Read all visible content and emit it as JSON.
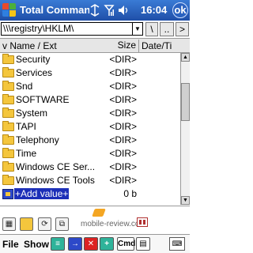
{
  "titlebar": {
    "title": "Total Comman",
    "clock": "16:04",
    "ok_label": "ok",
    "icons": [
      "start-logo-icon",
      "connectivity-icon",
      "signal-icon",
      "speaker-icon"
    ]
  },
  "pathbar": {
    "path": "\\\\\\registry\\HKLM\\",
    "buttons": [
      "\\",
      "..",
      ">"
    ]
  },
  "list_header": {
    "name_label": "v Name / Ext",
    "size_label": "Size",
    "date_label": "Date/Ti"
  },
  "files": [
    {
      "name": "Security",
      "size": "<DIR>"
    },
    {
      "name": "Services",
      "size": "<DIR>"
    },
    {
      "name": "Snd",
      "size": "<DIR>"
    },
    {
      "name": "SOFTWARE",
      "size": "<DIR>"
    },
    {
      "name": "System",
      "size": "<DIR>"
    },
    {
      "name": "TAPI",
      "size": "<DIR>"
    },
    {
      "name": "Telephony",
      "size": "<DIR>"
    },
    {
      "name": "Time",
      "size": "<DIR>"
    },
    {
      "name": "Windows CE Ser...",
      "size": "<DIR>"
    },
    {
      "name": "Windows CE Tools",
      "size": "<DIR>"
    },
    {
      "name": "+Add value+",
      "size": "0 b"
    }
  ],
  "watermark": "mobile-review.com",
  "menu": {
    "file_label": "File",
    "show_label": "Show",
    "cmd_label": "Cmd"
  }
}
